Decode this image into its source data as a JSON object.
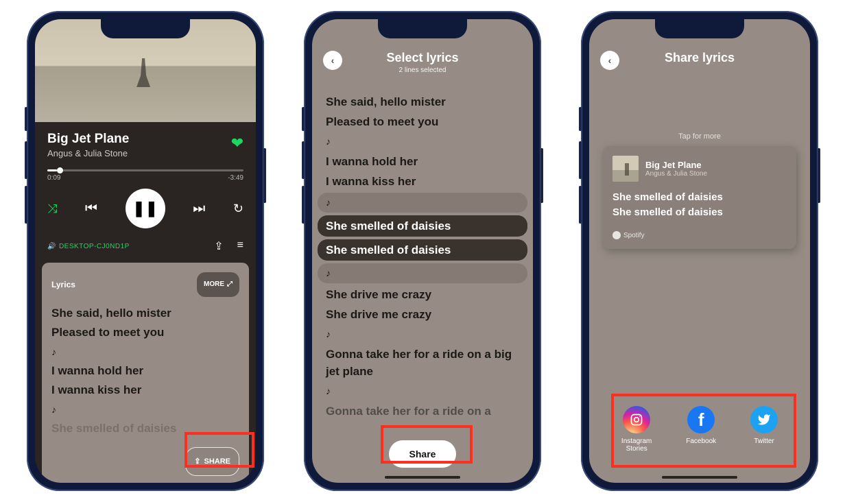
{
  "screen1": {
    "song_title": "Big Jet Plane",
    "artist": "Angus & Julia Stone",
    "time_current": "0:09",
    "time_remaining": "-3:49",
    "device_label": "DESKTOP-CJ0ND1P",
    "lyrics_heading": "Lyrics",
    "more_label": "MORE",
    "share_label": "SHARE",
    "lyrics_lines": [
      "She said, hello mister",
      "Pleased to meet you",
      "♪",
      "I wanna hold her",
      "I wanna kiss her",
      "♪",
      "She smelled of daisies"
    ]
  },
  "screen2": {
    "title": "Select lyrics",
    "subtitle": "2 lines selected",
    "share_label": "Share",
    "lines": [
      {
        "text": "She said, hello mister",
        "sel": false
      },
      {
        "text": "Pleased to meet you",
        "sel": false
      },
      {
        "text": "♪",
        "sel": false
      },
      {
        "text": "I wanna hold her",
        "sel": false
      },
      {
        "text": "I wanna kiss her",
        "sel": false
      },
      {
        "text": "♪",
        "sel": "adj"
      },
      {
        "text": "She smelled of daisies",
        "sel": true
      },
      {
        "text": "She smelled of daisies",
        "sel": true
      },
      {
        "text": "♪",
        "sel": "adj"
      },
      {
        "text": "She drive me crazy",
        "sel": false
      },
      {
        "text": "She drive me crazy",
        "sel": false
      },
      {
        "text": "♪",
        "sel": false
      },
      {
        "text": "Gonna take her for a ride on a big jet plane",
        "sel": false
      },
      {
        "text": "♪",
        "sel": false
      },
      {
        "text": "Gonna take her for a ride on a",
        "sel": false,
        "faded": true
      }
    ]
  },
  "screen3": {
    "title": "Share lyrics",
    "tap_more": "Tap for more",
    "card": {
      "song": "Big Jet Plane",
      "artist": "Angus & Julia Stone",
      "lines": [
        "She smelled of daisies",
        "She smelled of daisies"
      ],
      "provider": "Spotify"
    },
    "targets": {
      "instagram": "Instagram\nStories",
      "facebook": "Facebook",
      "twitter": "Twitter"
    }
  }
}
